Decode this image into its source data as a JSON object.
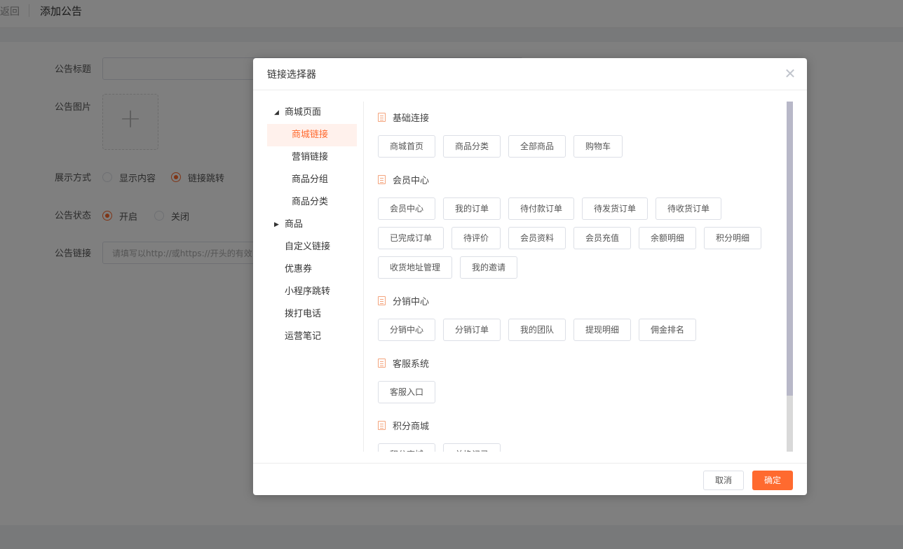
{
  "page": {
    "back_label": "返回",
    "title": "添加公告",
    "form": {
      "title_label": "公告标题",
      "image_label": "公告图片",
      "display_label": "展示方式",
      "display_options": [
        "显示内容",
        "链接跳转"
      ],
      "display_selected": "链接跳转",
      "status_label": "公告状态",
      "status_options": [
        "开启",
        "关闭"
      ],
      "status_selected": "开启",
      "link_label": "公告链接",
      "link_placeholder": "请填写以http://或https://开头的有效"
    }
  },
  "dialog": {
    "title": "链接选择器",
    "tree": [
      {
        "label": "商城页面",
        "caret": "down"
      },
      {
        "label": "商城链接",
        "active": true
      },
      {
        "label": "营销链接"
      },
      {
        "label": "商品分组"
      },
      {
        "label": "商品分类"
      },
      {
        "label": "商品",
        "caret": "right"
      },
      {
        "label": "自定义链接"
      },
      {
        "label": "优惠券"
      },
      {
        "label": "小程序跳转"
      },
      {
        "label": "拨打电话"
      },
      {
        "label": "运营笔记"
      }
    ],
    "sections": [
      {
        "title": "基础连接",
        "links": [
          "商城首页",
          "商品分类",
          "全部商品",
          "购物车"
        ]
      },
      {
        "title": "会员中心",
        "links": [
          "会员中心",
          "我的订单",
          "待付款订单",
          "待发货订单",
          "待收货订单",
          "已完成订单",
          "待评价",
          "会员资料",
          "会员充值",
          "余额明细",
          "积分明细",
          "收货地址管理",
          "我的邀请"
        ]
      },
      {
        "title": "分销中心",
        "links": [
          "分销中心",
          "分销订单",
          "我的团队",
          "提现明细",
          "佣金排名"
        ]
      },
      {
        "title": "客服系统",
        "links": [
          "客服入口"
        ]
      },
      {
        "title": "积分商城",
        "links": [
          "积分商城",
          "兑换记录"
        ]
      }
    ],
    "cancel_label": "取消",
    "confirm_label": "确定"
  },
  "colors": {
    "accent": "#ff6a2f",
    "active_bg": "#fff1ec"
  }
}
